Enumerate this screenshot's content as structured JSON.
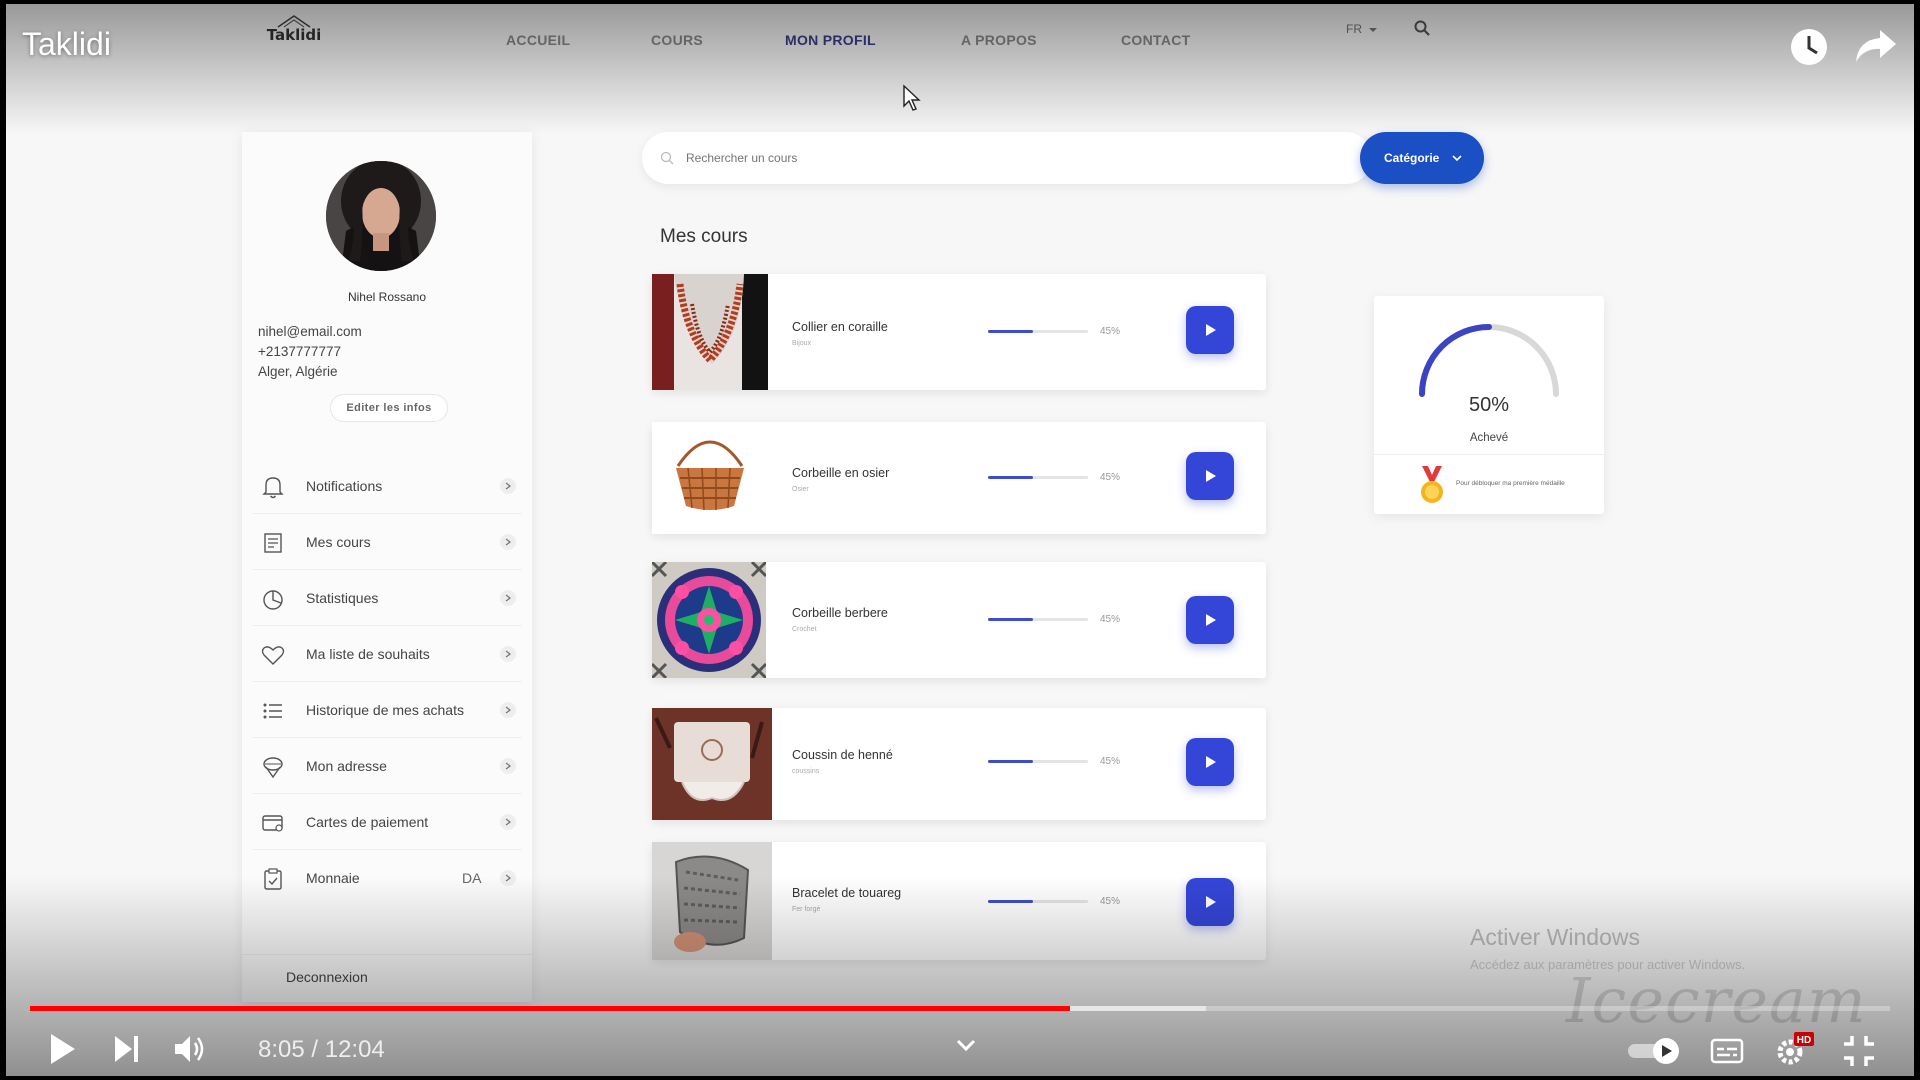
{
  "site": {
    "logo_text": "Taklidi",
    "nav": [
      "ACCUEIL",
      "COURS",
      "MON PROFIL",
      "A PROPOS",
      "CONTACT"
    ],
    "active_nav": "MON PROFIL",
    "lang": "FR"
  },
  "profile": {
    "name": "Nihel Rossano",
    "email": "nihel@email.com",
    "phone": "+2137777777",
    "location": "Alger, Algérie",
    "edit_label": "Editer les infos"
  },
  "menu": [
    {
      "label": "Notifications",
      "icon": "bell-icon"
    },
    {
      "label": "Mes cours",
      "icon": "courses-icon"
    },
    {
      "label": "Statistiques",
      "icon": "pie-chart-icon"
    },
    {
      "label": "Ma liste de souhaits",
      "icon": "heart-icon"
    },
    {
      "label": "Historique de mes achats",
      "icon": "list-icon"
    },
    {
      "label": "Mon adresse",
      "icon": "location-icon"
    },
    {
      "label": "Cartes de paiement",
      "icon": "credit-card-icon"
    },
    {
      "label": "Monnaie",
      "icon": "clipboard-icon",
      "value": "DA"
    }
  ],
  "logout_label": "Deconnexion",
  "search": {
    "placeholder": "Rechercher un cours",
    "category_label": "Catégorie"
  },
  "section_title": "Mes cours",
  "courses": [
    {
      "title": "Collier en coraille",
      "category": "Bijoux",
      "progress": 45,
      "progress_label": "45%"
    },
    {
      "title": "Corbeille en osier",
      "category": "Osier",
      "progress": 45,
      "progress_label": "45%"
    },
    {
      "title": "Corbeille berbere",
      "category": "Crochet",
      "progress": 45,
      "progress_label": "45%"
    },
    {
      "title": "Coussin de henné",
      "category": "coussins",
      "progress": 45,
      "progress_label": "45%"
    },
    {
      "title": "Bracelet de touareg",
      "category": "Fer forgé",
      "progress": 45,
      "progress_label": "45%"
    }
  ],
  "achievement": {
    "percent": 50,
    "percent_label": "50%",
    "label": "Achevé",
    "medal_text": "Pour débloquer ma première médaille"
  },
  "os_overlay": {
    "title": "Activer Windows",
    "subtitle": "Accédez aux paramètres pour activer Windows."
  },
  "watermark": "Icecream",
  "player": {
    "title": "Taklidi",
    "time": "8:05 / 12:04",
    "played_fraction": 0.5591,
    "buffered_fraction": 0.6323,
    "colors": {
      "played": "#ff0000",
      "accent": "#1b4fc4",
      "hd_badge": "#cc0000"
    }
  }
}
